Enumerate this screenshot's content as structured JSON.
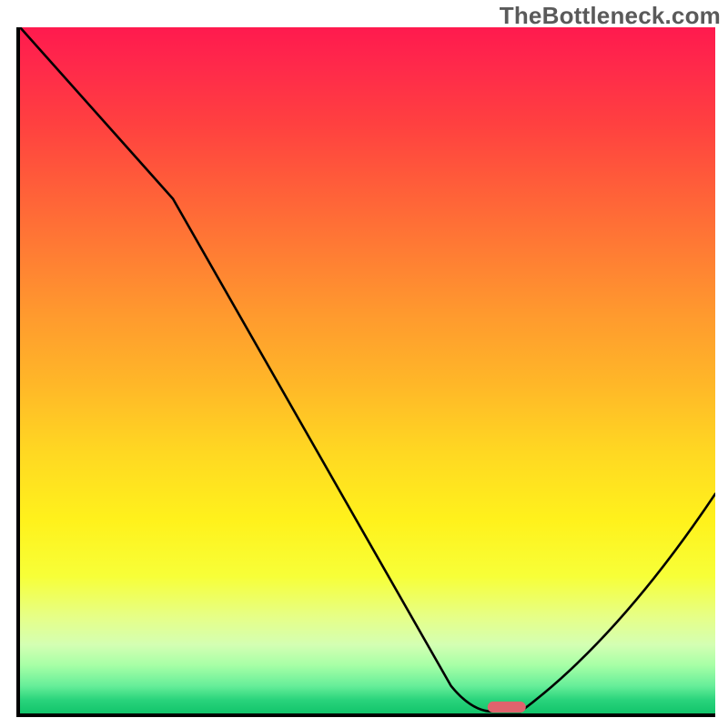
{
  "watermark": "TheBottleneck.com",
  "chart_data": {
    "type": "line",
    "title": "",
    "xlabel": "",
    "ylabel": "",
    "xlim": [
      0,
      100
    ],
    "ylim": [
      0,
      100
    ],
    "series": [
      {
        "name": "bottleneck-curve",
        "x": [
          0,
          22,
          62,
          68,
          72,
          100
        ],
        "values": [
          100,
          75,
          4,
          0,
          0,
          32
        ]
      }
    ],
    "marker": {
      "name": "optimal-point",
      "x": 70,
      "y": 0,
      "color": "#e0636d",
      "width_pct": 5.5,
      "height_pct": 1.6
    },
    "gradient_stops": [
      {
        "pct": 0,
        "color": "#ff1a4e"
      },
      {
        "pct": 50,
        "color": "#ffc824"
      },
      {
        "pct": 80,
        "color": "#fff21c"
      },
      {
        "pct": 100,
        "color": "#12c46b"
      }
    ],
    "grid": false,
    "legend": false
  }
}
